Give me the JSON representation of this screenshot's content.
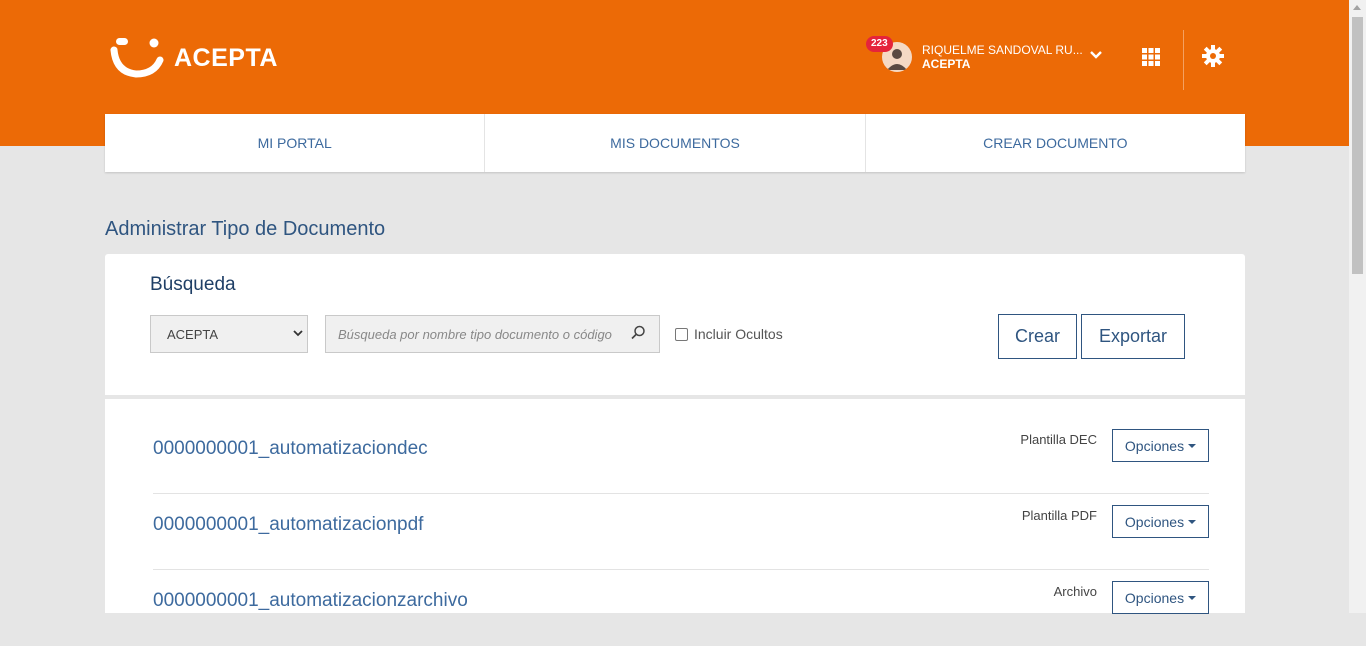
{
  "brand": {
    "name": "ACEPTA",
    "color": "#ec6a06"
  },
  "user": {
    "notifications": "223",
    "name": "RIQUELME SANDOVAL RU...",
    "org": "ACEPTA"
  },
  "header_icons": [
    "apps-grid-icon",
    "gear-icon",
    "chevron-down-icon",
    "user-avatar-icon"
  ],
  "nav": {
    "items": [
      "MI PORTAL",
      "MIS DOCUMENTOS",
      "CREAR DOCUMENTO"
    ]
  },
  "page": {
    "title": "Administrar Tipo de Documento"
  },
  "search": {
    "title": "Búsqueda",
    "select_value": "ACEPTA",
    "placeholder": "Búsqueda por nombre tipo documento o código",
    "include_hidden_label": "Incluir Ocultos",
    "include_hidden_checked": false,
    "create_label": "Crear",
    "export_label": "Exportar"
  },
  "documents": [
    {
      "name": "0000000001_automatizaciondec",
      "type": "Plantilla DEC",
      "options_label": "Opciones"
    },
    {
      "name": "0000000001_automatizacionpdf",
      "type": "Plantilla PDF",
      "options_label": "Opciones"
    },
    {
      "name": "0000000001_automatizacionzarchivo",
      "type": "Archivo",
      "options_label": "Opciones"
    }
  ]
}
